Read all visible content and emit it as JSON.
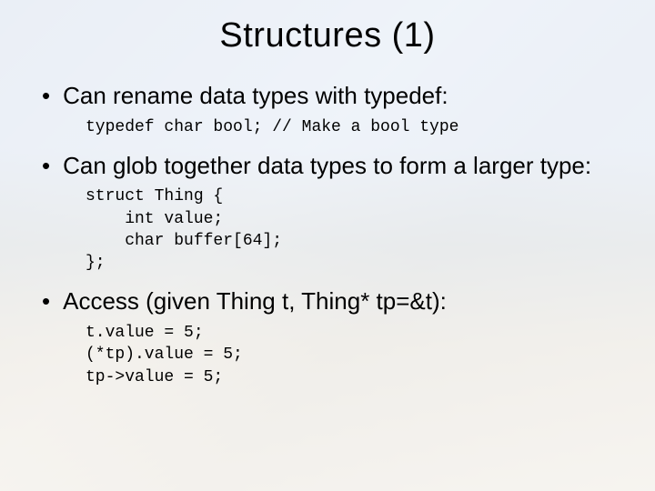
{
  "title": "Structures (1)",
  "bullets": [
    {
      "text": "Can rename data types with typedef:",
      "code": "typedef char bool; // Make a bool type"
    },
    {
      "text": "Can glob together data types to form a larger type:",
      "code": "struct Thing {\n    int value;\n    char buffer[64];\n};"
    },
    {
      "text": "Access (given Thing t, Thing* tp=&t):",
      "code": "t.value = 5;\n(*tp).value = 5;\ntp->value = 5;"
    }
  ]
}
